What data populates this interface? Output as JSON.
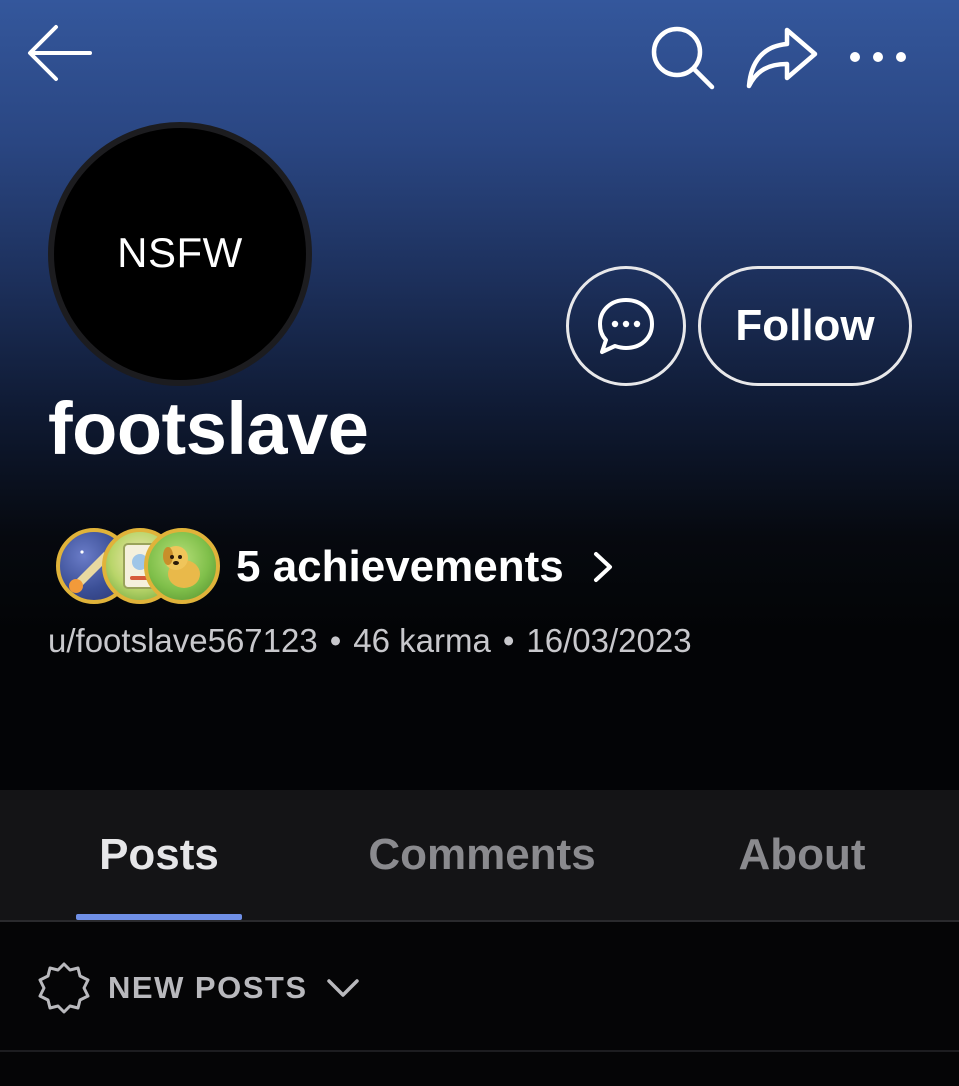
{
  "header": {
    "back_icon": "arrow-left-icon",
    "search_icon": "search-icon",
    "share_icon": "share-icon",
    "more_icon": "more-horizontal-icon"
  },
  "profile": {
    "avatar_label": "NSFW",
    "display_name": "footslave",
    "chat_icon": "chat-bubble-icon",
    "follow_label": "Follow",
    "achievements_label": "5 achievements",
    "username": "u/footslave567123",
    "separator": "•",
    "karma": "46 karma",
    "joined": "16/03/2023"
  },
  "tabs": [
    {
      "label": "Posts",
      "active": true
    },
    {
      "label": "Comments",
      "active": false
    },
    {
      "label": "About",
      "active": false
    }
  ],
  "sort": {
    "icon": "badge-star-icon",
    "label": "NEW POSTS",
    "chevron": "chevron-down-icon"
  },
  "colors": {
    "accent_underline": "#6f8fe6",
    "badge_border": "#e0b33a",
    "header_gradient_top": "#34579c"
  }
}
